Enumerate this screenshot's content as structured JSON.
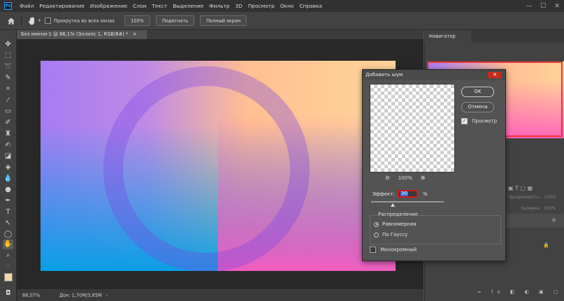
{
  "app": {
    "logo_text": "Ps"
  },
  "menu": {
    "items": [
      "Файл",
      "Редактирование",
      "Изображение",
      "Слои",
      "Текст",
      "Выделение",
      "Фильтр",
      "3D",
      "Просмотр",
      "Окно",
      "Справка"
    ]
  },
  "window_controls": {
    "minimize": "—",
    "maximize": "☐",
    "close": "✕"
  },
  "options_bar": {
    "scroll_all_label": "Прокрутка во всех окнах",
    "zoom_100": "100%",
    "fit_label": "Подогнать",
    "fullscreen_label": "Полный экран"
  },
  "document": {
    "tab_title": "Без имени-1 @ 86,1% (Эллипс 1, RGB/8#) *",
    "tab_close": "×"
  },
  "status": {
    "zoom": "86,07%",
    "doc_info": "Док: 1,70M/3,85M"
  },
  "navigator": {
    "title": "Навигатор"
  },
  "layers_panel": {
    "opacity_label": "прозрачность:",
    "opacity_val": "100%",
    "fill_label": "Заливка:",
    "fill_val": "100%"
  },
  "dialog": {
    "title": "Добавить шум",
    "close": "✕",
    "ok": "OK",
    "cancel": "Отмена",
    "preview_label": "Просмотр",
    "preview_checked": true,
    "zoom_value": "100%",
    "amount_label": "Эффект:",
    "amount_value": "30",
    "amount_unit": "%",
    "amount_fraction": 0.3,
    "distribution_title": "Распределение",
    "uniform_label": "Равномерная",
    "gaussian_label": "По Гауссу",
    "selected_distribution": "uniform",
    "mono_label": "Монохромный",
    "mono_checked": false
  },
  "colors": {
    "accent": "#31a8ff",
    "close_red": "#c42b1c",
    "highlight_red": "#d01818"
  }
}
